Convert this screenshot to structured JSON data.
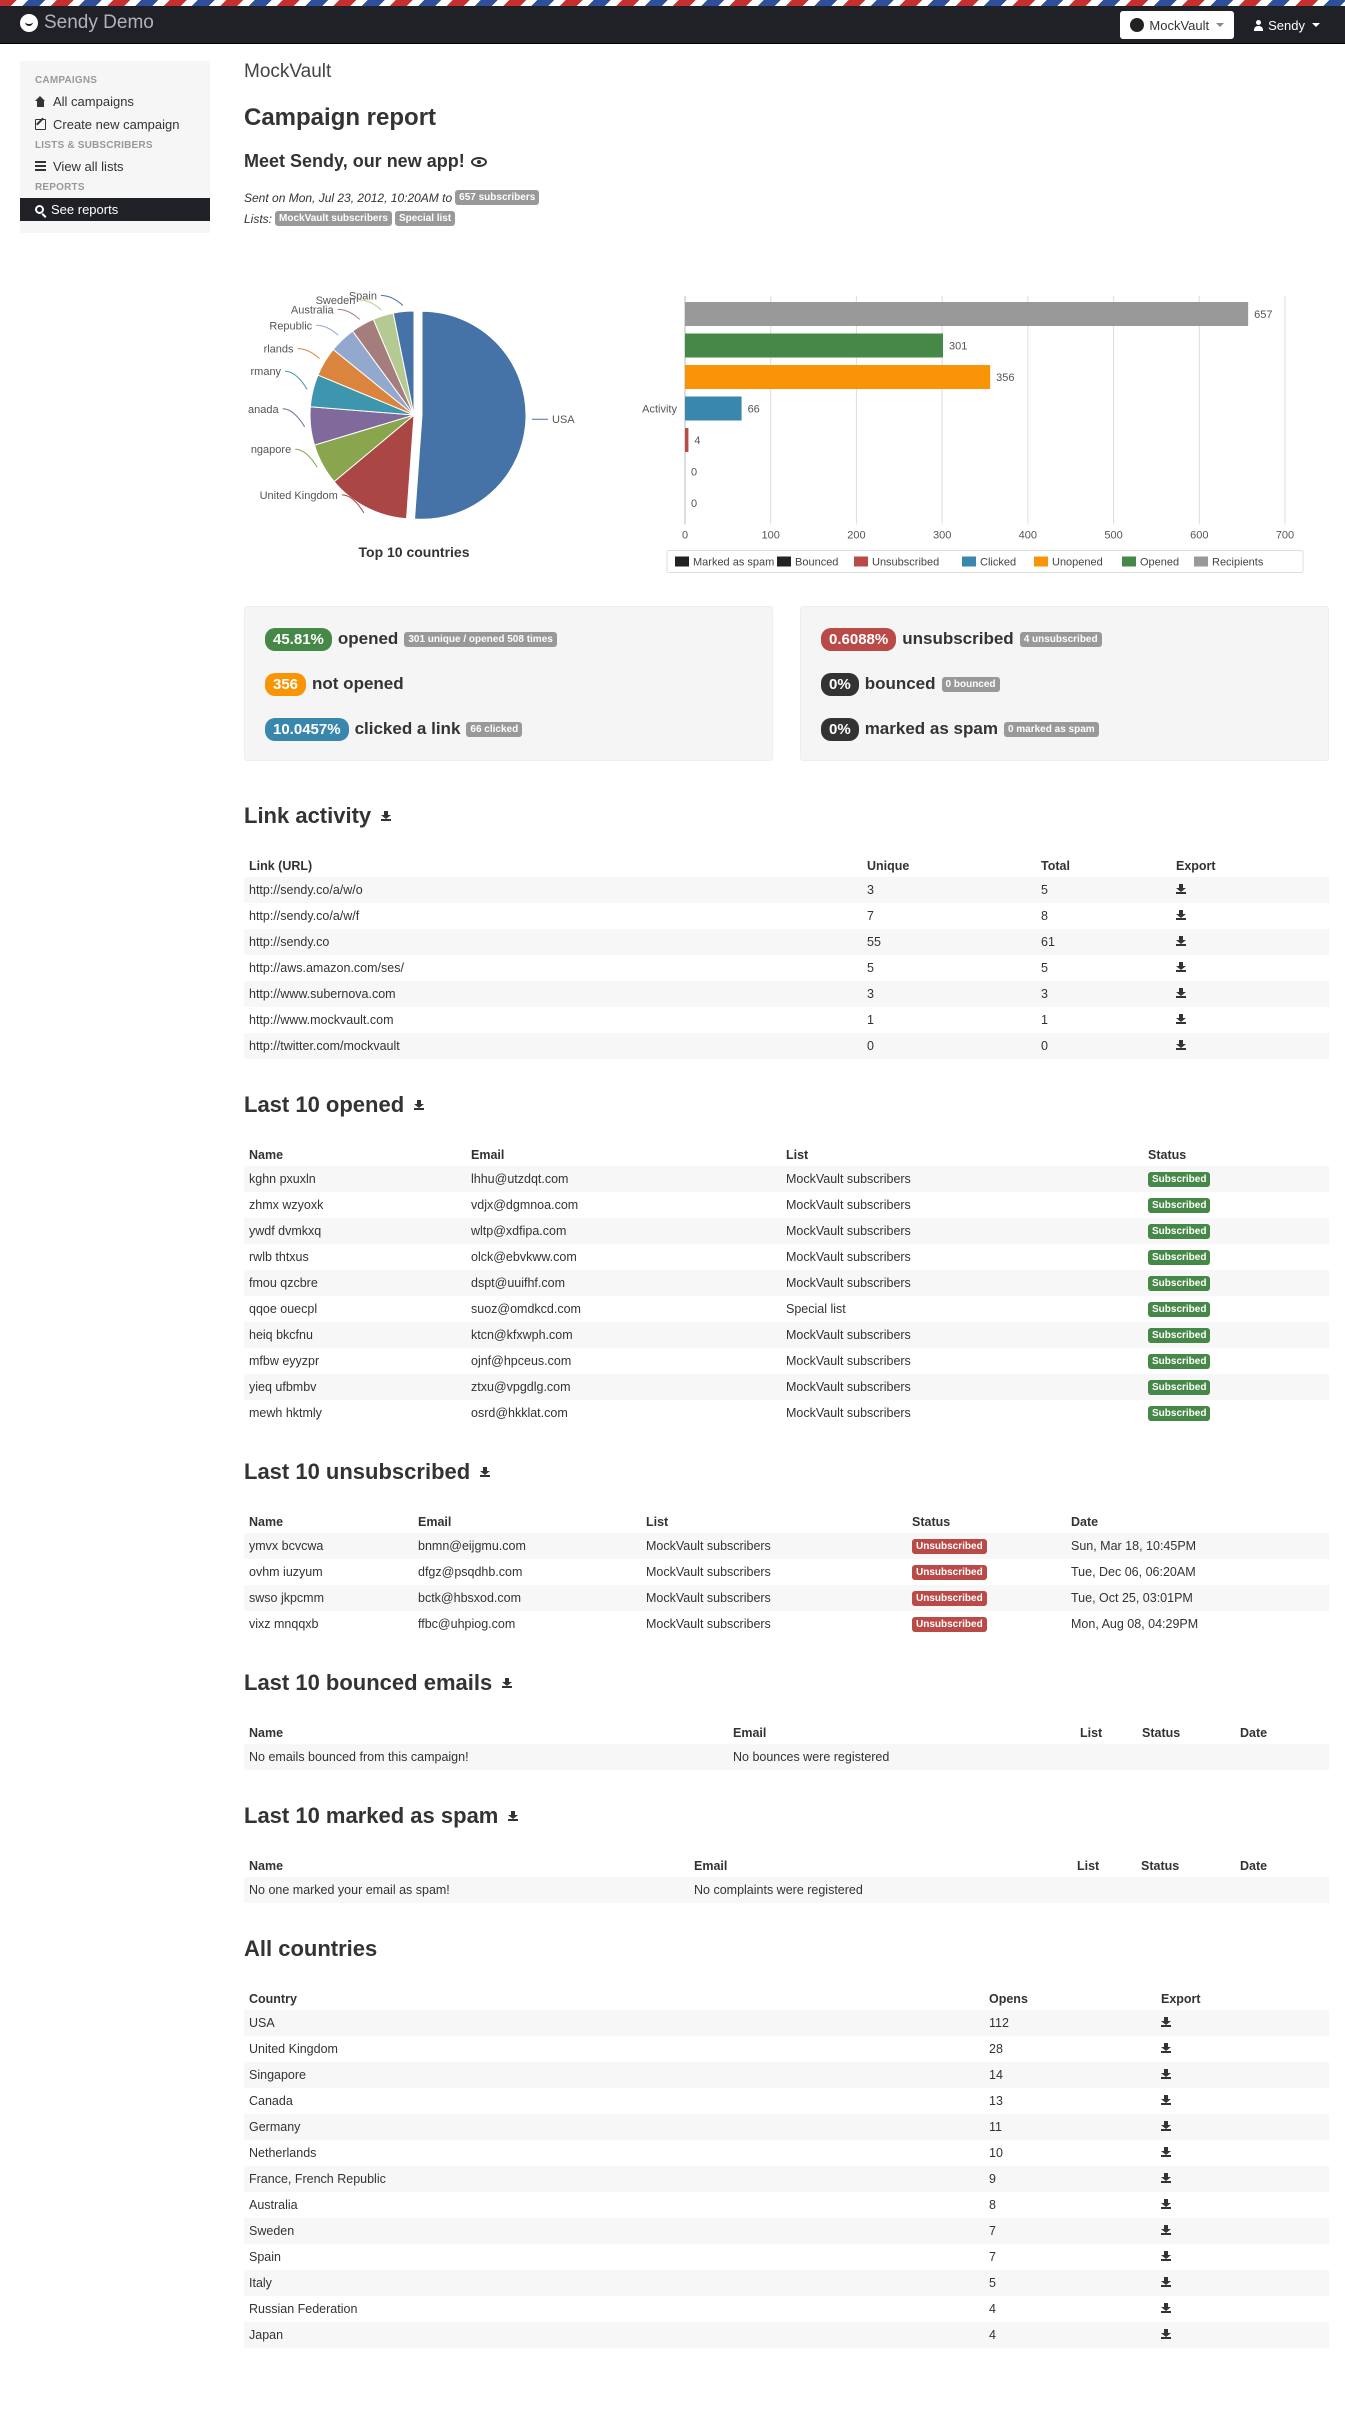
{
  "app": {
    "name": "Sendy Demo"
  },
  "navbar": {
    "brand_button": "MockVault",
    "user_button": "Sendy"
  },
  "sidebar": {
    "sections": [
      {
        "header": "CAMPAIGNS",
        "items": [
          {
            "label": "All campaigns",
            "icon": "home-icon"
          },
          {
            "label": "Create new campaign",
            "icon": "edit-icon"
          }
        ]
      },
      {
        "header": "LISTS & SUBSCRIBERS",
        "items": [
          {
            "label": "View all lists",
            "icon": "list-icon"
          }
        ]
      },
      {
        "header": "REPORTS",
        "items": [
          {
            "label": "See reports",
            "icon": "search-icon",
            "active": true
          }
        ]
      }
    ]
  },
  "header": {
    "brand": "MockVault",
    "title": "Campaign report",
    "campaign": "Meet Sendy, our new app!"
  },
  "meta": {
    "sent_prefix": "Sent on Mon, Jul 23, 2012, 10:20AM to",
    "subscribers_label": "657 subscribers",
    "lists_prefix": "Lists:",
    "lists": [
      "MockVault subscribers",
      "Special list"
    ]
  },
  "chart_data": [
    {
      "type": "pie",
      "title": "Top 10 countries",
      "labels": [
        "USA",
        "United Kingdom",
        "Singapore",
        "Canada",
        "Germany",
        "Netherlands",
        "France, French Republic",
        "Australia",
        "Sweden",
        "Spain"
      ],
      "tick_labels": [
        "USA",
        "United Kingdom",
        "ngapore",
        "anada",
        "rmany",
        "rlands",
        "Republic",
        "Australia",
        "Sweden",
        "Spain"
      ],
      "values": [
        112,
        28,
        14,
        13,
        11,
        10,
        9,
        8,
        7,
        7
      ],
      "colors": [
        "#4572a7",
        "#aa4643",
        "#89a54e",
        "#80699b",
        "#3d96ae",
        "#db843d",
        "#92a8cd",
        "#a47d7c",
        "#b5ca92",
        "#4572a7"
      ]
    },
    {
      "type": "bar",
      "orientation": "horizontal",
      "categories": [
        "Activity"
      ],
      "xlim": [
        0,
        700
      ],
      "xticks": [
        0,
        100,
        200,
        300,
        400,
        500,
        600,
        700
      ],
      "series": [
        {
          "name": "Recipients",
          "values": [
            657
          ],
          "color": "#999999"
        },
        {
          "name": "Opened",
          "values": [
            301
          ],
          "color": "#468847"
        },
        {
          "name": "Unopened",
          "values": [
            356
          ],
          "color": "#f89406"
        },
        {
          "name": "Clicked",
          "values": [
            66
          ],
          "color": "#3a87ad"
        },
        {
          "name": "Unsubscribed",
          "values": [
            4
          ],
          "color": "#b94a48"
        },
        {
          "name": "Bounced",
          "values": [
            0
          ],
          "color": "#222222"
        },
        {
          "name": "Marked as spam",
          "values": [
            0
          ],
          "color": "#222222"
        }
      ],
      "legend": [
        "Marked as spam",
        "Bounced",
        "Unsubscribed",
        "Clicked",
        "Unopened",
        "Opened",
        "Recipients"
      ],
      "legend_position": "bottom"
    }
  ],
  "stats_left": {
    "opened_pct": "45.81%",
    "opened_label": "opened",
    "opened_detail": "301 unique / opened 508 times",
    "unopened_count": "356",
    "unopened_label": "not opened",
    "clicked_pct": "10.0457%",
    "clicked_label": "clicked a link",
    "clicked_detail": "66 clicked"
  },
  "stats_right": {
    "unsub_pct": "0.6088%",
    "unsub_label": "unsubscribed",
    "unsub_detail": "4 unsubscribed",
    "bounced_pct": "0%",
    "bounced_label": "bounced",
    "bounced_detail": "0 bounced",
    "spam_pct": "0%",
    "spam_label": "marked as spam",
    "spam_detail": "0 marked as spam"
  },
  "link_activity": {
    "title": "Link activity",
    "columns": [
      "Link (URL)",
      "Unique",
      "Total",
      "Export"
    ],
    "rows": [
      [
        "http://sendy.co/a/w/o",
        "3",
        "5"
      ],
      [
        "http://sendy.co/a/w/f",
        "7",
        "8"
      ],
      [
        "http://sendy.co",
        "55",
        "61"
      ],
      [
        "http://aws.amazon.com/ses/",
        "5",
        "5"
      ],
      [
        "http://www.subernova.com",
        "3",
        "3"
      ],
      [
        "http://www.mockvault.com",
        "1",
        "1"
      ],
      [
        "http://twitter.com/mockvault",
        "0",
        "0"
      ]
    ]
  },
  "last_opened": {
    "title": "Last 10 opened",
    "columns": [
      "Name",
      "Email",
      "List",
      "Status"
    ],
    "rows": [
      [
        "kghn pxuxln",
        "lhhu@utzdqt.com",
        "MockVault subscribers",
        "Subscribed"
      ],
      [
        "zhmx wzyoxk",
        "vdjx@dgmnoa.com",
        "MockVault subscribers",
        "Subscribed"
      ],
      [
        "ywdf dvmkxq",
        "wltp@xdfipa.com",
        "MockVault subscribers",
        "Subscribed"
      ],
      [
        "rwlb thtxus",
        "olck@ebvkww.com",
        "MockVault subscribers",
        "Subscribed"
      ],
      [
        "fmou qzcbre",
        "dspt@uuifhf.com",
        "MockVault subscribers",
        "Subscribed"
      ],
      [
        "qqoe ouecpl",
        "suoz@omdkcd.com",
        "Special list",
        "Subscribed"
      ],
      [
        "heiq bkcfnu",
        "ktcn@kfxwph.com",
        "MockVault subscribers",
        "Subscribed"
      ],
      [
        "mfbw eyyzpr",
        "ojnf@hpceus.com",
        "MockVault subscribers",
        "Subscribed"
      ],
      [
        "yieq ufbmbv",
        "ztxu@vpgdlg.com",
        "MockVault subscribers",
        "Subscribed"
      ],
      [
        "mewh hktmly",
        "osrd@hkklat.com",
        "MockVault subscribers",
        "Subscribed"
      ]
    ]
  },
  "last_unsub": {
    "title": "Last 10 unsubscribed",
    "columns": [
      "Name",
      "Email",
      "List",
      "Status",
      "Date"
    ],
    "rows": [
      [
        "ymvx bcvcwa",
        "bnmn@eijgmu.com",
        "MockVault subscribers",
        "Unsubscribed",
        "Sun, Mar 18, 10:45PM"
      ],
      [
        "ovhm iuzyum",
        "dfgz@psqdhb.com",
        "MockVault subscribers",
        "Unsubscribed",
        "Tue, Dec 06, 06:20AM"
      ],
      [
        "swso jkpcmm",
        "bctk@hbsxod.com",
        "MockVault subscribers",
        "Unsubscribed",
        "Tue, Oct 25, 03:01PM"
      ],
      [
        "vixz mnqqxb",
        "ffbc@uhpiog.com",
        "MockVault subscribers",
        "Unsubscribed",
        "Mon, Aug 08, 04:29PM"
      ]
    ]
  },
  "last_bounced": {
    "title": "Last 10 bounced emails",
    "columns": [
      "Name",
      "Email",
      "List",
      "Status",
      "Date"
    ],
    "empty_name": "No emails bounced from this campaign!",
    "empty_email": "No bounces were registered"
  },
  "last_spam": {
    "title": "Last 10 marked as spam",
    "columns": [
      "Name",
      "Email",
      "List",
      "Status",
      "Date"
    ],
    "empty_name": "No one marked your email as spam!",
    "empty_email": "No complaints were registered"
  },
  "countries": {
    "title": "All countries",
    "columns": [
      "Country",
      "Opens",
      "Export"
    ],
    "rows": [
      [
        "USA",
        "112"
      ],
      [
        "United Kingdom",
        "28"
      ],
      [
        "Singapore",
        "14"
      ],
      [
        "Canada",
        "13"
      ],
      [
        "Germany",
        "11"
      ],
      [
        "Netherlands",
        "10"
      ],
      [
        "France, French Republic",
        "9"
      ],
      [
        "Australia",
        "8"
      ],
      [
        "Sweden",
        "7"
      ],
      [
        "Spain",
        "7"
      ],
      [
        "Italy",
        "5"
      ],
      [
        "Russian Federation",
        "4"
      ],
      [
        "Japan",
        "4"
      ]
    ]
  }
}
